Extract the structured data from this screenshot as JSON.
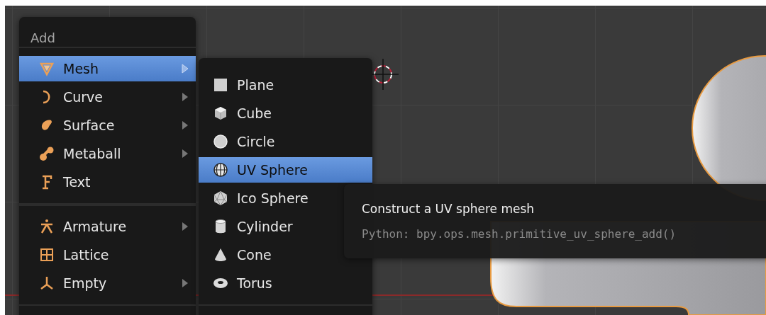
{
  "menu": {
    "title": "Add",
    "sections": [
      {
        "items": [
          {
            "label": "Mesh",
            "kind": "mesh",
            "submenu": true,
            "selected": true
          },
          {
            "label": "Curve",
            "kind": "curve",
            "submenu": true,
            "selected": false
          },
          {
            "label": "Surface",
            "kind": "surface",
            "submenu": true,
            "selected": false
          },
          {
            "label": "Metaball",
            "kind": "metaball",
            "submenu": true,
            "selected": false
          },
          {
            "label": "Text",
            "kind": "text",
            "submenu": false,
            "selected": false
          }
        ]
      },
      {
        "items": [
          {
            "label": "Armature",
            "kind": "armature",
            "submenu": true,
            "selected": false
          },
          {
            "label": "Lattice",
            "kind": "lattice",
            "submenu": false,
            "selected": false
          },
          {
            "label": "Empty",
            "kind": "empty",
            "submenu": true,
            "selected": false
          }
        ]
      }
    ]
  },
  "submenu": {
    "items": [
      {
        "label": "Plane",
        "kind": "plane",
        "selected": false
      },
      {
        "label": "Cube",
        "kind": "cube",
        "selected": false
      },
      {
        "label": "Circle",
        "kind": "circle",
        "selected": false
      },
      {
        "label": "UV Sphere",
        "kind": "uvsphere",
        "selected": true
      },
      {
        "label": "Ico Sphere",
        "kind": "icosphere",
        "selected": false
      },
      {
        "label": "Cylinder",
        "kind": "cylinder",
        "selected": false
      },
      {
        "label": "Cone",
        "kind": "cone",
        "selected": false
      },
      {
        "label": "Torus",
        "kind": "torus",
        "selected": false
      }
    ]
  },
  "tooltip": {
    "title": "Construct a UV sphere mesh",
    "python": "Python: bpy.ops.mesh.primitive_uv_sphere_add()"
  }
}
